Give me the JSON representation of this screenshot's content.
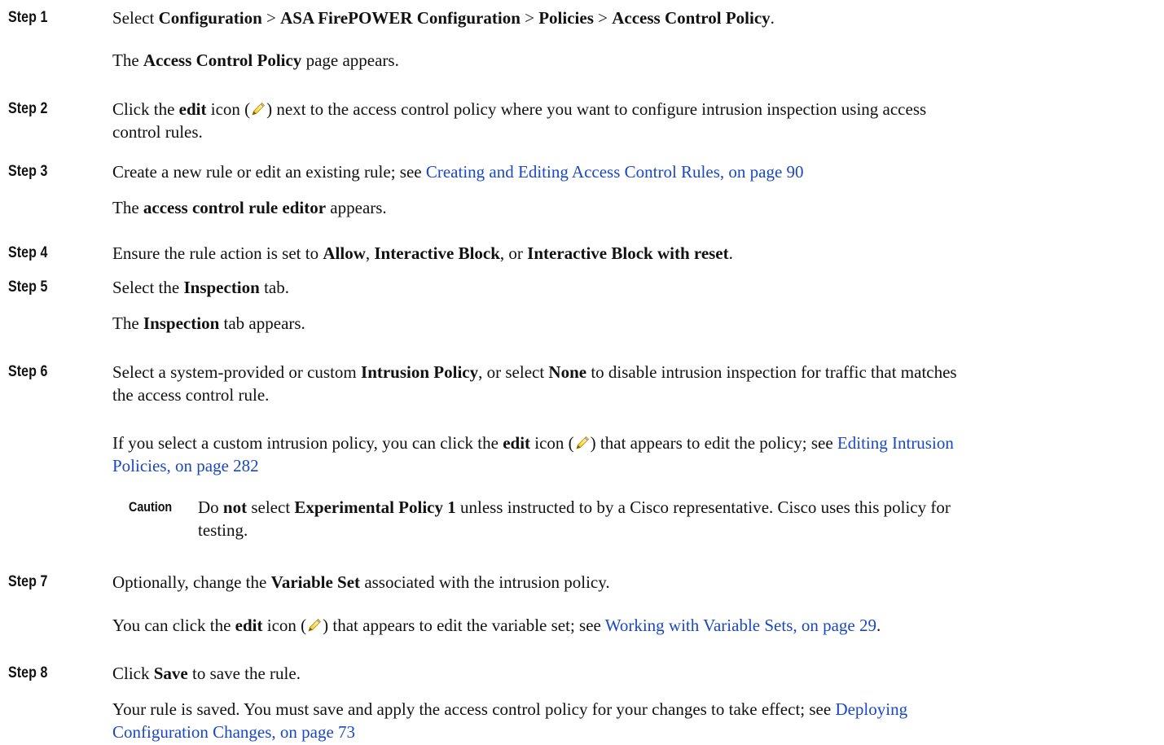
{
  "steps": {
    "s1": {
      "label": "Step 1",
      "t1": "Select ",
      "b1": "Configuration",
      "t2": " > ",
      "b2": "ASA FirePOWER Configuration",
      "t3": " > ",
      "b3": "Policies",
      "t4": " > ",
      "b4": "Access Control Policy",
      "t5": ".",
      "r1": "The ",
      "rb1": "Access Control Policy",
      "r2": " page appears."
    },
    "s2": {
      "label": "Step 2",
      "t1": "Click the ",
      "b1": "edit",
      "t2": " icon (",
      "t3": ") next to the access control policy where you want to configure intrusion inspection using access",
      "l2": "control rules."
    },
    "s3": {
      "label": "Step 3",
      "t1": "Create a new rule or edit an existing rule; see ",
      "link": "Creating and Editing Access Control Rules, on page 90",
      "r1": "The ",
      "rb1": "access control rule editor",
      "r2": " appears."
    },
    "s4": {
      "label": "Step 4",
      "t1": "Ensure the rule action is set to ",
      "b1": "Allow",
      "t2": ", ",
      "b2": "Interactive Block",
      "t3": ", or ",
      "b3": "Interactive Block with reset",
      "t4": "."
    },
    "s5": {
      "label": "Step 5",
      "t1": "Select the ",
      "b1": "Inspection",
      "t2": " tab.",
      "r1": "The ",
      "rb1": "Inspection",
      "r2": " tab appears."
    },
    "s6": {
      "label": "Step 6",
      "t1": "Select a system-provided or custom ",
      "b1": "Intrusion Policy",
      "t2": ", or select ",
      "b2": "None",
      "t3": " to disable intrusion inspection for traffic that matches",
      "l2": "the access control rule.",
      "p1": "If you select a custom intrusion policy, you can click the ",
      "pb1": "edit",
      "p2": " icon (",
      "p3": ") that appears to edit the policy; see ",
      "plink1": "Editing Intrusion",
      "plink2": "Policies, on page 282",
      "caution": {
        "label": "Caution",
        "t1": "Do ",
        "b1": "not",
        "t2": " select ",
        "b2": "Experimental Policy 1",
        "t3": " unless instructed to by a Cisco representative. Cisco uses this policy for",
        "l2": "testing."
      }
    },
    "s7": {
      "label": "Step 7",
      "t1": "Optionally, change the ",
      "b1": "Variable Set",
      "t2": " associated with the intrusion policy.",
      "p1": "You can click the ",
      "pb1": "edit",
      "p2": " icon (",
      "p3": ") that appears to edit the variable set; see ",
      "plink": "Working with Variable Sets, on page 29",
      "p4": "."
    },
    "s8": {
      "label": "Step 8",
      "t1": "Click ",
      "b1": "Save",
      "t2": " to save the rule.",
      "r1": "Your rule is saved. You must save and apply the access control policy for your changes to take effect; see ",
      "rlink1": "Deploying",
      "rlink2": "Configuration Changes, on page 73"
    }
  },
  "icons": {
    "edit": "pencil-icon"
  },
  "colors": {
    "link": "#1a48c4"
  }
}
